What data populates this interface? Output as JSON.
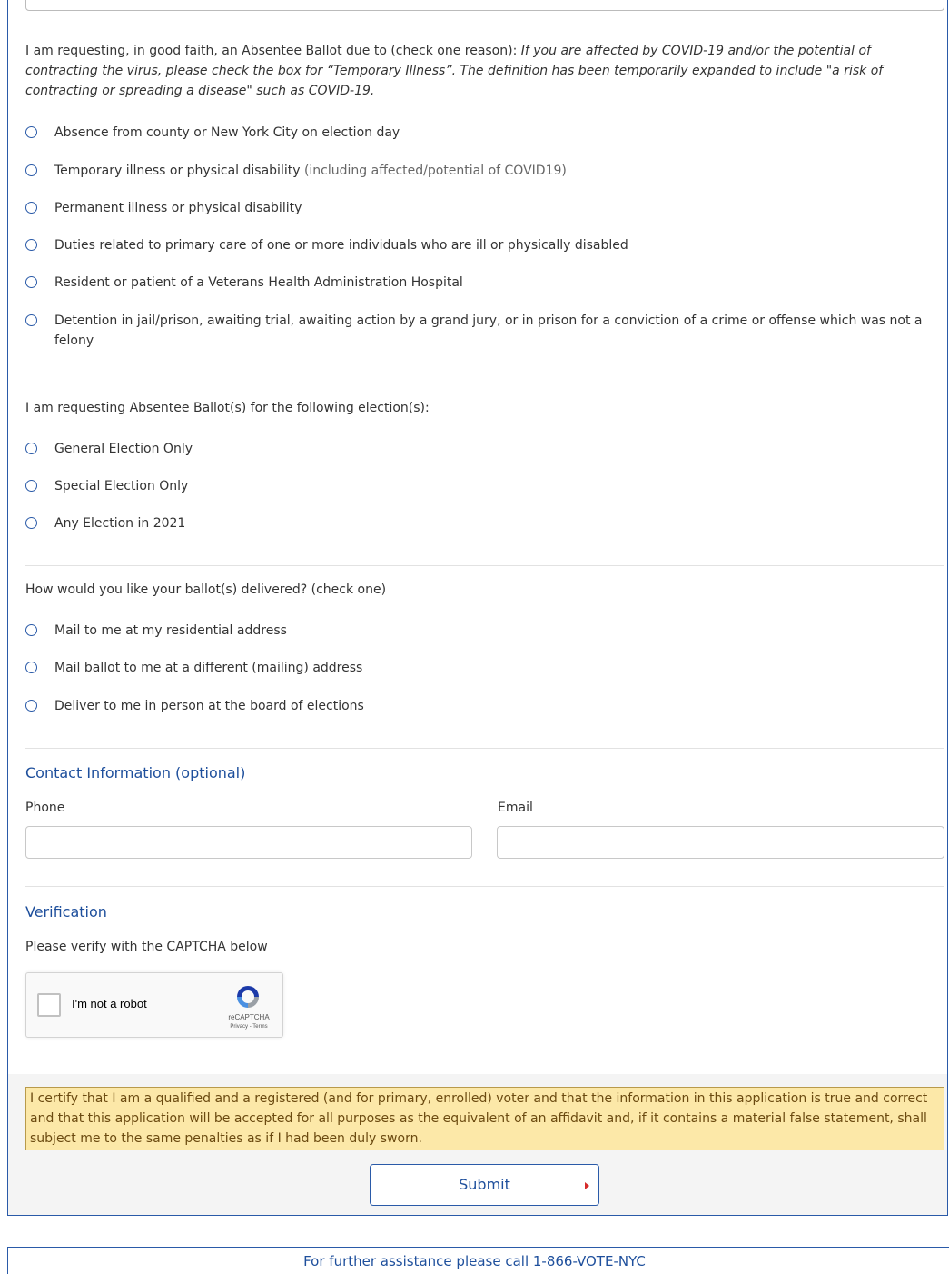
{
  "reason": {
    "intro": "I am requesting, in good faith, an Absentee Ballot due to (check one reason): ",
    "intro_note": "If you are affected by COVID-19 and/or the potential of contracting the virus, please check the box for “Temporary Illness”. The definition has been temporarily expanded to include \"a risk of contracting or spreading a disease\" such as COVID-19.",
    "options": [
      {
        "label": "Absence from county or New York City on election day",
        "note": ""
      },
      {
        "label": "Temporary illness or physical disability",
        "note": " (including affected/potential of COVID19)"
      },
      {
        "label": "Permanent illness or physical disability",
        "note": ""
      },
      {
        "label": "Duties related to primary care of one or more individuals who are ill or physically disabled",
        "note": ""
      },
      {
        "label": "Resident or patient of a Veterans Health Administration Hospital",
        "note": ""
      },
      {
        "label": "Detention in jail/prison, awaiting trial, awaiting action by a grand jury, or in prison for a conviction of a crime or offense which was not a felony",
        "note": ""
      }
    ]
  },
  "election": {
    "question": "I am requesting Absentee Ballot(s) for the following election(s):",
    "options": [
      "General Election Only",
      "Special Election Only",
      "Any Election in 2021"
    ]
  },
  "delivery": {
    "question": "How would you like your ballot(s) delivered? (check one)",
    "options": [
      "Mail to me at my residential address",
      "Mail ballot to me at a different (mailing) address",
      "Deliver to me in person at the board of elections"
    ]
  },
  "contact": {
    "title": "Contact Information (optional)",
    "phone_label": "Phone",
    "email_label": "Email",
    "phone_value": "",
    "email_value": ""
  },
  "verification": {
    "title": "Verification",
    "instruction": "Please verify with the CAPTCHA below",
    "captcha_label": "I'm not a robot",
    "captcha_brand": "reCAPTCHA",
    "captcha_links": "Privacy - Terms"
  },
  "certify_text": "I certify that I am a qualified and a registered (and for primary, enrolled) voter and that the information in this application is true and correct and that this application will be accepted for all purposes as the equivalent of an affidavit and, if it contains a material false statement, shall subject me to the same penalties as if I had been duly sworn.",
  "submit_label": "Submit",
  "footer_text": "For further assistance please call 1-866-VOTE-NYC",
  "colors": {
    "accent": "#2a5aa8",
    "section_title": "#1e4f9c",
    "certify_bg": "#fce8a8",
    "submit_arrow": "#d62b2b"
  }
}
